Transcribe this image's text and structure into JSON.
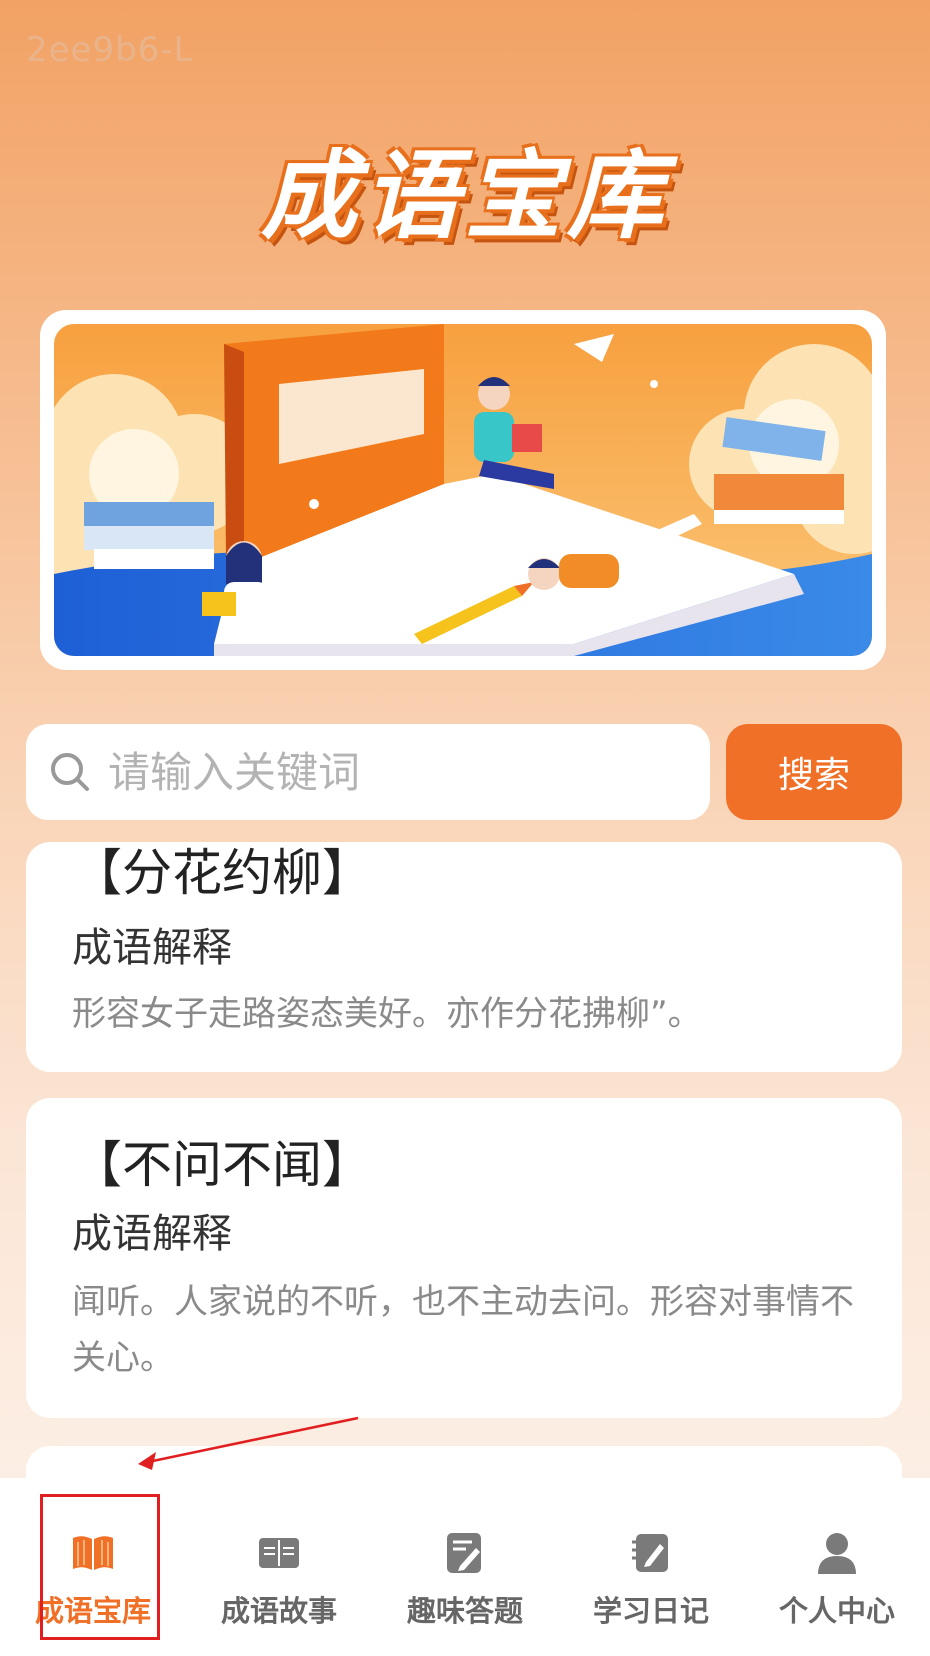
{
  "watermark": "2ee9b6-L",
  "app": {
    "title": "成语宝库"
  },
  "search": {
    "placeholder": "请输入关键词",
    "button_label": "搜索"
  },
  "idioms": [
    {
      "name": "【分花约柳】",
      "sub": "成语解释",
      "desc": "形容女子走路姿态美好。亦作分花拂柳”。"
    },
    {
      "name": "【不问不闻】",
      "sub": "成语解释",
      "desc": "闻听。人家说的不听，也不主动去问。形容对事情不关心。"
    }
  ],
  "tabbar": {
    "items": [
      {
        "label": "成语宝库",
        "icon": "open-book-icon",
        "active": true
      },
      {
        "label": "成语故事",
        "icon": "story-book-icon",
        "active": false
      },
      {
        "label": "趣味答题",
        "icon": "quiz-pencil-icon",
        "active": false
      },
      {
        "label": "学习日记",
        "icon": "notebook-pencil-icon",
        "active": false
      },
      {
        "label": "个人中心",
        "icon": "user-icon",
        "active": false
      }
    ]
  },
  "colors": {
    "accent": "#f07027",
    "inactive": "#666666",
    "annotation": "#e02020"
  }
}
